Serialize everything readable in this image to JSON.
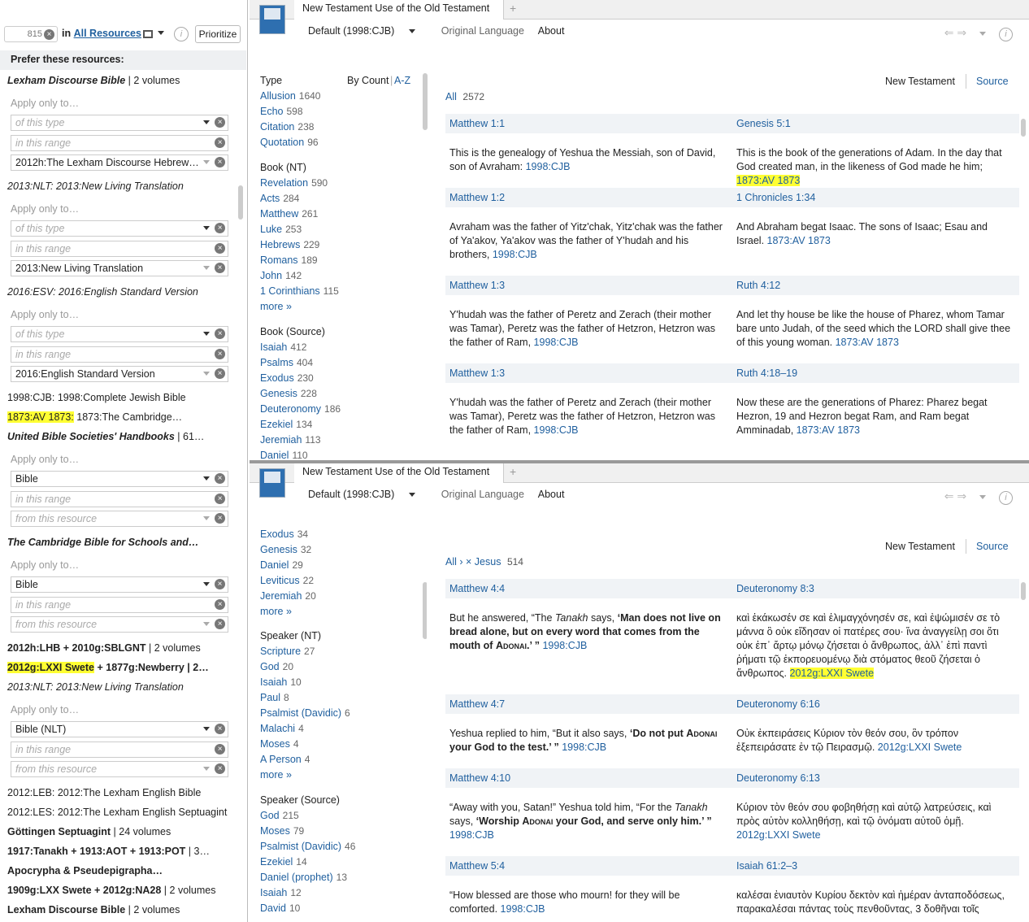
{
  "left": {
    "search_count": "815",
    "in_label": "in",
    "all_resources": "All Resources",
    "prioritize": "Prioritize",
    "prefer_header": "Prefer these resources:",
    "apply_only": "Apply only to…",
    "ph_type": "of this type",
    "ph_range": "in this range",
    "ph_resource": "from this resource",
    "items": [
      {
        "title": "Lexham Discourse Bible",
        "rest": " | 2 volumes"
      },
      {
        "field": "2012h:The Lexham Discourse Hebrew…"
      },
      {
        "title": "2013:NLT: 2013:New Living Translation"
      },
      {
        "field": "2013:New Living Translation"
      },
      {
        "title": "2016:ESV: 2016:English Standard Version"
      },
      {
        "field": "2016:English Standard Version"
      },
      {
        "title": "1998:CJB: 1998:Complete Jewish Bible"
      },
      {
        "hl": "1873:AV 1873:",
        "rest": " 1873:The Cambridge…"
      },
      {
        "title": "United Bible Societies' Handbooks",
        "rest": " | 61…"
      },
      {
        "field": "Bible"
      },
      {
        "title": "The Cambridge Bible for Schools and…"
      },
      {
        "field": "Bible"
      },
      {
        "title": "2012h:LHB + 2010g:SBLGNT",
        "rest": " | 2 volumes"
      },
      {
        "hl": "2012g:LXXI Swete",
        "rest": " + 1877g:Newberry | 2…"
      },
      {
        "title": "2013:NLT: 2013:New Living Translation"
      },
      {
        "field": "Bible (NLT)"
      },
      {
        "title": "2012:LEB: 2012:The Lexham English Bible"
      },
      {
        "title": "2012:LES: 2012:The Lexham English Septuagint"
      },
      {
        "title": "Göttingen Septuagint",
        "rest": " | 24 volumes"
      },
      {
        "title": "1917:Tanakh + 1913:AOT + 1913:POT",
        "rest": " | 3…"
      },
      {
        "title": "Apocrypha & Pseudepigrapha…"
      },
      {
        "title": "1909g:LXX Swete + 2012g:NA28",
        "rest": " | 2 volumes"
      },
      {
        "title": "Lexham Discourse Bible",
        "rest": " | 2 volumes"
      }
    ]
  },
  "win": {
    "tab_title": "New Testament Use of the Old Testament",
    "default": "Default (1998:CJB)",
    "orig": "Original Language",
    "about": "About",
    "nt": "New Testament",
    "source": "Source",
    "type": "Type",
    "bycount": "By Count",
    "az": "A-Z",
    "more": "more »"
  },
  "top": {
    "types": [
      [
        "Allusion",
        "1640"
      ],
      [
        "Echo",
        "598"
      ],
      [
        "Citation",
        "238"
      ],
      [
        "Quotation",
        "96"
      ]
    ],
    "book_nt_h": "Book (NT)",
    "book_nt": [
      [
        "Revelation",
        "590"
      ],
      [
        "Acts",
        "284"
      ],
      [
        "Matthew",
        "261"
      ],
      [
        "Luke",
        "253"
      ],
      [
        "Hebrews",
        "229"
      ],
      [
        "Romans",
        "189"
      ],
      [
        "John",
        "142"
      ],
      [
        "1 Corinthians",
        "115"
      ]
    ],
    "book_src_h": "Book (Source)",
    "book_src": [
      [
        "Isaiah",
        "412"
      ],
      [
        "Psalms",
        "404"
      ],
      [
        "Exodus",
        "230"
      ],
      [
        "Genesis",
        "228"
      ],
      [
        "Deuteronomy",
        "186"
      ],
      [
        "Ezekiel",
        "134"
      ],
      [
        "Jeremiah",
        "113"
      ],
      [
        "Daniel",
        "110"
      ]
    ],
    "all": "All",
    "all_count": "2572",
    "rows": [
      {
        "a": "Matthew 1:1",
        "b": "Genesis 5:1",
        "l": "This is the genealogy of Yeshua the Messiah, son of David, son of Avraham:",
        "lr": "1998:CJB",
        "r": "This is the book of the generations of Adam. In the day that God created man, in the likeness of God made he him;",
        "rr": "1873:AV 1873"
      },
      {
        "a": "Matthew 1:2",
        "b": "1 Chronicles 1:34",
        "l": "Avraham was the father of Yitz'chak, Yitz'chak was the father of Ya'akov, Ya'akov was the father of Y'hudah and his brothers,",
        "lr": "1998:CJB",
        "r": "And Abraham begat Isaac. The sons of Isaac; Esau and Israel.",
        "rr": "1873:AV 1873"
      },
      {
        "a": "Matthew 1:3",
        "b": "Ruth 4:12",
        "l": "Y'hudah was the father of Peretz and Zerach (their mother was Tamar), Peretz was the father of Hetzron, Hetzron was the father of Ram,",
        "lr": "1998:CJB",
        "r": "And let thy house be like the house of Pharez, whom Tamar bare unto Judah, of the seed which the LORD shall give thee of this young woman.",
        "rr": "1873:AV 1873"
      },
      {
        "a": "Matthew 1:3",
        "b": "Ruth 4:18–19",
        "l": "Y'hudah was the father of Peretz and Zerach (their mother was Tamar), Peretz was the father of Hetzron, Hetzron was the father of Ram,",
        "lr": "1998:CJB",
        "r": "Now these are the generations of Pharez: Pharez begat Hezron, 19 and Hezron begat Ram, and Ram begat Amminadab,",
        "rr": "1873:AV 1873"
      }
    ]
  },
  "bottom": {
    "book_src": [
      [
        "Exodus",
        "34"
      ],
      [
        "Genesis",
        "32"
      ],
      [
        "Daniel",
        "29"
      ],
      [
        "Leviticus",
        "22"
      ],
      [
        "Jeremiah",
        "20"
      ]
    ],
    "spk_nt_h": "Speaker (NT)",
    "spk_nt": [
      [
        "Scripture",
        "27"
      ],
      [
        "God",
        "20"
      ],
      [
        "Isaiah",
        "10"
      ],
      [
        "Paul",
        "8"
      ],
      [
        "Psalmist (Davidic)",
        "6"
      ],
      [
        "Malachi",
        "4"
      ],
      [
        "Moses",
        "4"
      ],
      [
        "A Person",
        "4"
      ]
    ],
    "spk_src_h": "Speaker (Source)",
    "spk_src": [
      [
        "God",
        "215"
      ],
      [
        "Moses",
        "79"
      ],
      [
        "Psalmist (Davidic)",
        "46"
      ],
      [
        "Ezekiel",
        "14"
      ],
      [
        "Daniel (prophet)",
        "13"
      ],
      [
        "Isaiah",
        "12"
      ],
      [
        "David",
        "10"
      ]
    ],
    "crumb_all": "All ›",
    "crumb_jesus": "× Jesus",
    "crumb_count": "514",
    "rows": [
      {
        "a": "Matthew 4:4",
        "b": "Deuteronomy 8:3",
        "lr": "1998:CJB",
        "r": "καὶ ἐκάκωσέν σε καὶ ἐλιμαγχόνησέν σε, καὶ ἐψώμισέν σε τὸ μάννα ὃ οὐκ εἴδησαν οἱ πατέρες σου· ἵνα ἀναγγείλῃ σοι ὅτι οὐκ ἐπ᾽ ἄρτῳ μόνῳ ζήσεται ὁ ἄνθρωπος, ἀλλ᾽ ἐπὶ παντὶ ῥήματι τῷ ἐκπορευομένῳ διὰ στόματος θεοῦ ζήσεται ὁ ἄνθρωπος.",
        "rr": "2012g:LXXI Swete"
      },
      {
        "a": "Matthew 4:7",
        "b": "Deuteronomy 6:16",
        "lr": "1998:CJB",
        "r": "Οὐκ ἐκπειράσεις Κύριον τὸν θεόν σου, ὃν τρόπον ἐξεπειράσατε ἐν τῷ Πειρασμῷ.",
        "rr": "2012g:LXXI Swete"
      },
      {
        "a": "Matthew 4:10",
        "b": "Deuteronomy 6:13",
        "lr": "1998:CJB",
        "r": "Κύριον τὸν θεόν σου φοβηθήσῃ καὶ αὐτῷ λατρεύσεις, καὶ πρὸς αὐτὸν κολληθήσῃ, καὶ τῷ ὀνόματι αὐτοῦ ὀμῇ.",
        "rr": "2012g:LXXI Swete"
      },
      {
        "a": "Matthew 5:4",
        "b": "Isaiah 61:2–3",
        "l": "“How blessed are those who mourn! for they will be comforted.",
        "lr": "1998:CJB",
        "r": "καλέσαι ἐνιαυτὸν Κυρίου δεκτὸν καὶ ἡμέραν ἀνταποδόσεως, παρακαλέσαι πάντας τοὺς πενθοῦντας, 3 δοθῆναι τοῖς"
      }
    ]
  }
}
